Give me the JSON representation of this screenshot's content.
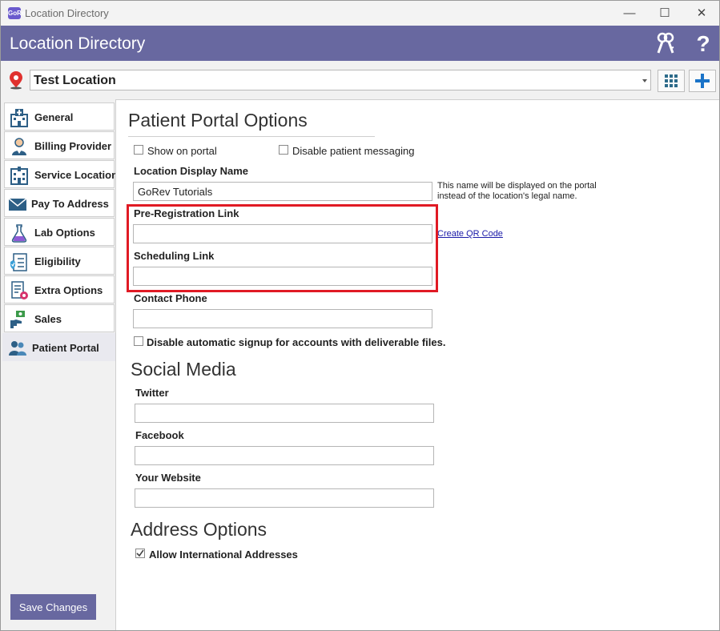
{
  "window": {
    "icon_text": "GoRev",
    "title": "Location Directory",
    "controls": [
      "—",
      "☐",
      "✕"
    ]
  },
  "header": {
    "title": "Location Directory"
  },
  "location": {
    "selected": "Test Location"
  },
  "sidebar": {
    "items": [
      {
        "label": "General",
        "icon": "hospital-icon"
      },
      {
        "label": "Billing Provider",
        "icon": "doctor-icon"
      },
      {
        "label": "Service Location",
        "icon": "building-icon"
      },
      {
        "label": "Pay To Address",
        "icon": "envelope-icon"
      },
      {
        "label": "Lab Options",
        "icon": "flask-icon"
      },
      {
        "label": "Eligibility",
        "icon": "checklist-icon"
      },
      {
        "label": "Extra Options",
        "icon": "document-gear-icon"
      },
      {
        "label": "Sales",
        "icon": "money-hand-icon"
      },
      {
        "label": "Patient Portal",
        "icon": "users-icon"
      }
    ],
    "active": "Patient Portal",
    "save_label": "Save Changes"
  },
  "portal": {
    "heading": "Patient Portal Options",
    "show_on_portal": "Show on portal",
    "disable_messaging": "Disable patient messaging",
    "display_name_label": "Location Display Name",
    "display_name_value": "GoRev Tutorials",
    "display_name_note": "This name will be displayed on the portal instead of the location's legal name.",
    "prereg_label": "Pre-Registration Link",
    "prereg_value": "",
    "create_qr": "Create QR Code",
    "scheduling_label": "Scheduling Link",
    "scheduling_value": "",
    "contact_phone_label": "Contact Phone",
    "contact_phone_value": "",
    "disable_signup": "Disable automatic signup for accounts with deliverable files."
  },
  "social": {
    "heading": "Social Media",
    "twitter_label": "Twitter",
    "facebook_label": "Facebook",
    "website_label": "Your Website"
  },
  "address": {
    "heading": "Address Options",
    "allow_international": "Allow International Addresses",
    "allow_international_checked": true
  },
  "colors": {
    "header": "#6868a0",
    "highlight": "#e01a24",
    "link": "#1a1aa8",
    "add_button": "#1a73c8"
  }
}
